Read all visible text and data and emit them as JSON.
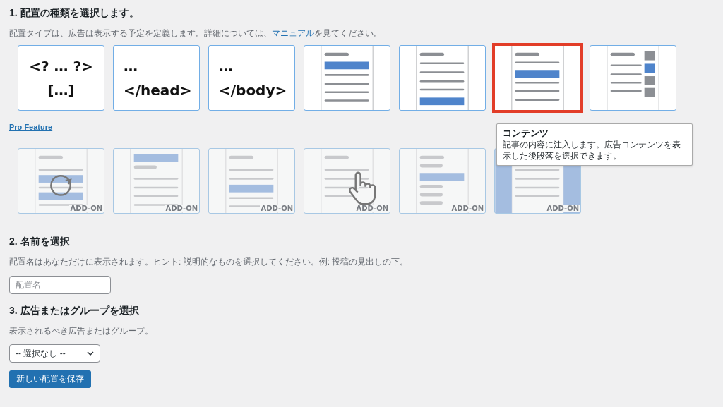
{
  "type_section": {
    "heading": "1. 配置の種類を選択します。",
    "description_before": "配置タイプは、広告は表示する予定を定義します。詳細については、",
    "manual_link": "マニュアル",
    "description_after": "を見てください。"
  },
  "placements": [
    {
      "kind": "php",
      "lines": [
        "<? … ?>",
        "[…]"
      ],
      "selected": false
    },
    {
      "kind": "head",
      "lines": [
        "…",
        "</head>"
      ],
      "selected": false
    },
    {
      "kind": "body",
      "lines": [
        "…",
        "</body>"
      ],
      "selected": false
    },
    {
      "kind": "before",
      "selected": false
    },
    {
      "kind": "after",
      "selected": false
    },
    {
      "kind": "content",
      "selected": true
    },
    {
      "kind": "sidebar",
      "selected": false
    }
  ],
  "tooltip": {
    "title": "コンテンツ",
    "text": "記事の内容に注入します。広告コンテンツを表示した後段落を選択できます。"
  },
  "pro_feature_link": "Pro Feature",
  "pro_placements": [
    {
      "kind": "random",
      "badge": "ADD-ON"
    },
    {
      "kind": "headline",
      "badge": "ADD-ON"
    },
    {
      "kind": "middle",
      "badge": "ADD-ON"
    },
    {
      "kind": "custom",
      "badge": "ADD-ON"
    },
    {
      "kind": "archive",
      "badge": "ADD-ON"
    },
    {
      "kind": "background",
      "badge": "ADD-ON"
    }
  ],
  "name_section": {
    "heading": "2. 名前を選択",
    "description": "配置名はあなただけに表示されます。ヒント: 説明的なものを選択してください。例: 投稿の見出しの下。",
    "name_field": {
      "placeholder": "配置名"
    }
  },
  "item_section": {
    "heading": "3. 広告またはグループを選択",
    "description": "表示されるべき広告またはグループ。",
    "select": {
      "value": "-- 選択なし --"
    }
  },
  "save_button": "新しい配置を保存"
}
